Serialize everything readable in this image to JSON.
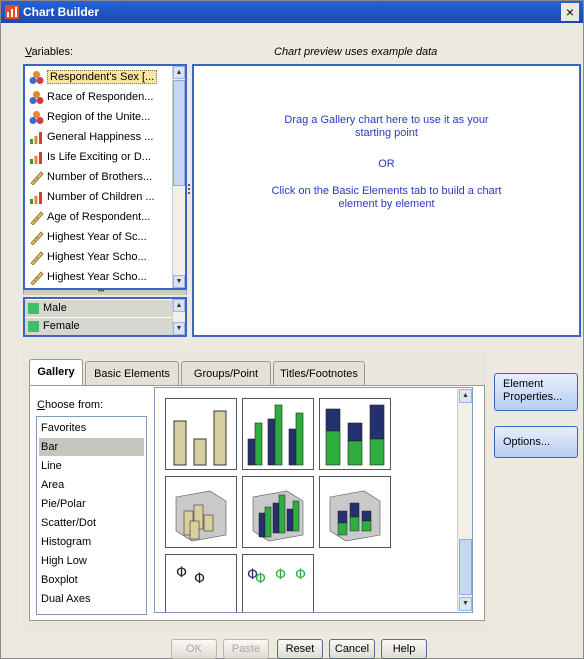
{
  "window": {
    "title": "Chart Builder",
    "close_label": "×"
  },
  "variables": {
    "label": "Variables:",
    "items": [
      {
        "label": "Respondent's Sex [...",
        "icon": "nominal-icon",
        "selected": true
      },
      {
        "label": "Race of Responden...",
        "icon": "nominal-icon"
      },
      {
        "label": "Region of the Unite...",
        "icon": "nominal-icon"
      },
      {
        "label": "General Happiness ...",
        "icon": "ordinal-icon"
      },
      {
        "label": "Is Life Exciting or D...",
        "icon": "ordinal-icon"
      },
      {
        "label": "Number of Brothers...",
        "icon": "scale-icon"
      },
      {
        "label": "Number of Children ...",
        "icon": "ordinal-icon"
      },
      {
        "label": "Age of Respondent...",
        "icon": "scale-icon"
      },
      {
        "label": "Highest Year of Sc...",
        "icon": "scale-icon"
      },
      {
        "label": "Highest Year Scho...",
        "icon": "scale-icon"
      },
      {
        "label": "Highest Year Scho...",
        "icon": "scale-icon"
      }
    ]
  },
  "categories": {
    "items": [
      {
        "label": "Male"
      },
      {
        "label": "Female"
      }
    ]
  },
  "preview": {
    "header": "Chart preview uses example data",
    "line1": "Drag a Gallery chart here to use it as your",
    "line2": "starting point",
    "or": "OR",
    "line3": "Click on the Basic Elements tab to build a chart",
    "line4": "element by element"
  },
  "tabs": [
    {
      "label": "Gallery",
      "active": true
    },
    {
      "label": "Basic Elements"
    },
    {
      "label": "Groups/Point ID"
    },
    {
      "label": "Titles/Footnotes"
    }
  ],
  "gallery": {
    "choose_label": "Choose from:",
    "types": [
      "Favorites",
      "Bar",
      "Line",
      "Area",
      "Pie/Polar",
      "Scatter/Dot",
      "Histogram",
      "High Low",
      "Boxplot",
      "Dual Axes"
    ],
    "selected_type": "Bar"
  },
  "side_buttons": {
    "element_properties": "Element Properties...",
    "options": "Options..."
  },
  "buttons": {
    "ok": "OK",
    "paste": "Paste",
    "reset": "Reset",
    "cancel": "Cancel",
    "help": "Help"
  },
  "colors": {
    "titlebar": "#1a48b0",
    "focus_border": "#3d63c7",
    "preview_text": "#2a3bbf",
    "bar_tan": "#d8cfa0",
    "bar_navy": "#25306e",
    "bar_green": "#2fae3f"
  }
}
